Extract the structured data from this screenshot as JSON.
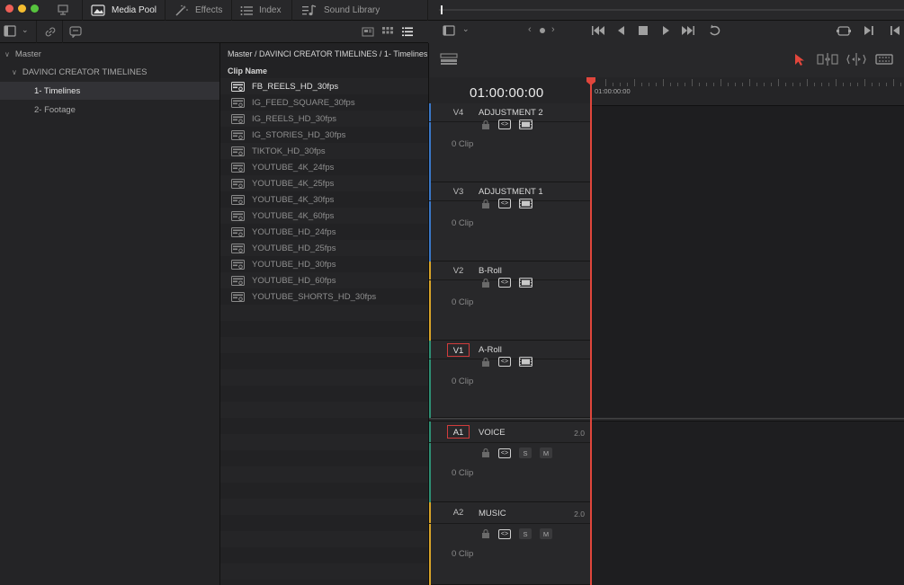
{
  "window": {
    "traffic_lights": [
      "#ee5f57",
      "#f5bd30",
      "#57c43e"
    ]
  },
  "tabs": [
    {
      "label": "Media Pool",
      "icon": "media-pool-icon",
      "active": true
    },
    {
      "label": "Effects",
      "icon": "effects-wand-icon",
      "active": false
    },
    {
      "label": "Index",
      "icon": "index-list-icon",
      "active": false
    },
    {
      "label": "Sound Library",
      "icon": "sound-library-icon",
      "active": false
    }
  ],
  "sidebar": {
    "items": [
      {
        "label": "Master",
        "level": 0,
        "expanded": true,
        "selected": false
      },
      {
        "label": "DAVINCI CREATOR TIMELINES",
        "level": 1,
        "expanded": true,
        "selected": false
      },
      {
        "label": "1- Timelines",
        "level": 2,
        "selected": true
      },
      {
        "label": "2- Footage",
        "level": 2,
        "selected": false
      }
    ]
  },
  "clip_panel": {
    "breadcrumb": "Master / DAVINCI CREATOR TIMELINES / 1- Timelines",
    "column_header": "Clip Name",
    "clips": [
      "FB_REELS_HD_30fps",
      "IG_FEED_SQUARE_30fps",
      "IG_REELS_HD_30fps",
      "IG_STORIES_HD_30fps",
      "TIKTOK_HD_30fps",
      "YOUTUBE_4K_24fps",
      "YOUTUBE_4K_25fps",
      "YOUTUBE_4K_30fps",
      "YOUTUBE_4K_60fps",
      "YOUTUBE_HD_24fps",
      "YOUTUBE_HD_25fps",
      "YOUTUBE_HD_30fps",
      "YOUTUBE_HD_60fps",
      "YOUTUBE_SHORTS_HD_30fps"
    ]
  },
  "timeline": {
    "timecode": "01:00:00:00",
    "ruler_timecode": "01:00:00:00",
    "playhead_color": "#e0463c",
    "tracks": [
      {
        "id": "V4",
        "name": "ADJUSTMENT 2",
        "clips": "0 Clip",
        "type": "video",
        "boxed": false,
        "color": "#3a78c8"
      },
      {
        "id": "V3",
        "name": "ADJUSTMENT 1",
        "clips": "0 Clip",
        "type": "video",
        "boxed": false,
        "color": "#3a78c8"
      },
      {
        "id": "V2",
        "name": "B-Roll",
        "clips": "0 Clip",
        "type": "video",
        "boxed": false,
        "color": "#d8a429"
      },
      {
        "id": "V1",
        "name": "A-Roll",
        "clips": "0 Clip",
        "type": "video",
        "boxed": true,
        "color": "#2f8f74"
      },
      {
        "id": "A1",
        "name": "VOICE",
        "clips": "0 Clip",
        "type": "audio",
        "boxed": true,
        "volume": "2.0",
        "solo": "S",
        "mute": "M",
        "color": "#2f8f74"
      },
      {
        "id": "A2",
        "name": "MUSIC",
        "clips": "0 Clip",
        "type": "audio",
        "boxed": false,
        "volume": "2.0",
        "solo": "S",
        "mute": "M",
        "color": "#d8a429"
      }
    ]
  }
}
